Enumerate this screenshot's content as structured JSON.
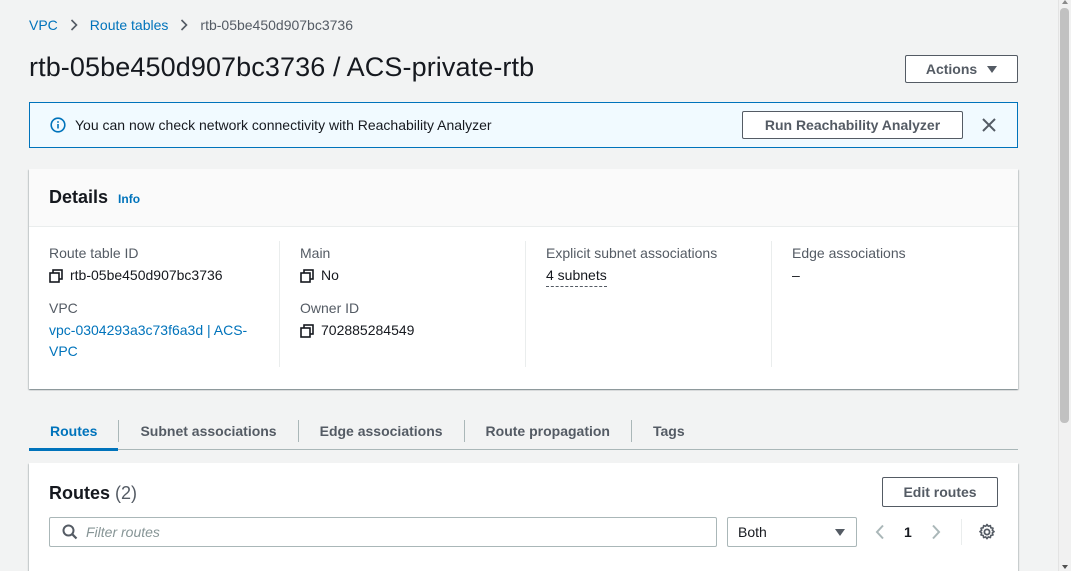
{
  "breadcrumb": {
    "items": [
      "VPC",
      "Route tables"
    ],
    "current": "rtb-05be450d907bc3736"
  },
  "title": "rtb-05be450d907bc3736 / ACS-private-rtb",
  "actions_label": "Actions",
  "flash": {
    "message": "You can now check network connectivity with Reachability Analyzer",
    "button_label": "Run Reachability Analyzer"
  },
  "details": {
    "heading": "Details",
    "info_label": "Info",
    "route_table_id_label": "Route table ID",
    "route_table_id": "rtb-05be450d907bc3736",
    "vpc_label": "VPC",
    "vpc_value": "vpc-0304293a3c73f6a3d | ACS-VPC",
    "main_label": "Main",
    "main_value": "No",
    "owner_id_label": "Owner ID",
    "owner_id": "702885284549",
    "subnet_assoc_label": "Explicit subnet associations",
    "subnet_assoc_value": "4 subnets",
    "edge_assoc_label": "Edge associations",
    "edge_assoc_value": "–"
  },
  "tabs": [
    {
      "label": "Routes",
      "active": true
    },
    {
      "label": "Subnet associations",
      "active": false
    },
    {
      "label": "Edge associations",
      "active": false
    },
    {
      "label": "Route propagation",
      "active": false
    },
    {
      "label": "Tags",
      "active": false
    }
  ],
  "routes": {
    "title": "Routes",
    "count": "(2)",
    "edit_label": "Edit routes",
    "filter_placeholder": "Filter routes",
    "select_value": "Both",
    "page": "1"
  },
  "colors": {
    "link": "#0073bb",
    "flash_bg": "#f1faff",
    "text": "#16191f",
    "secondary_text": "#545b64"
  }
}
